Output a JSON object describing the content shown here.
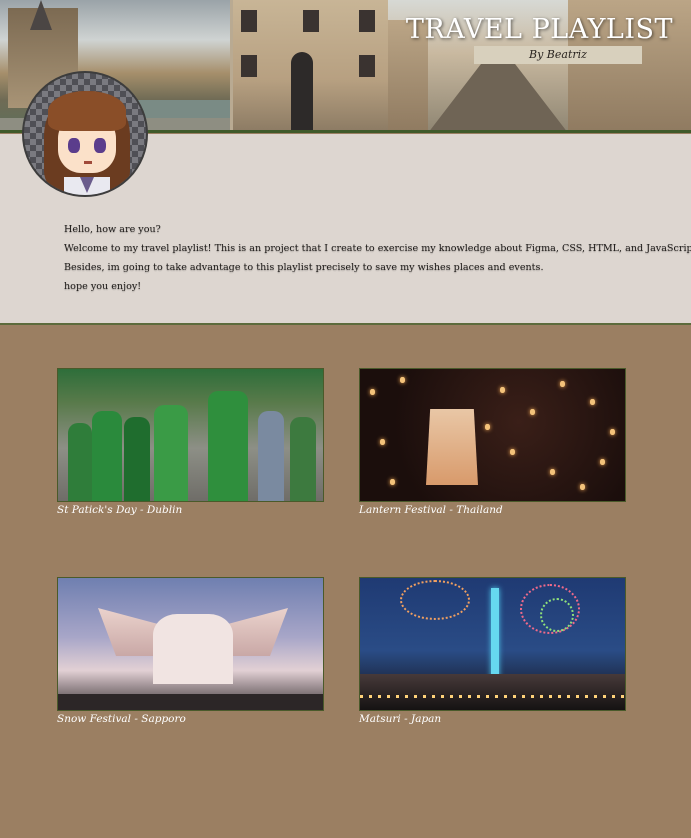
{
  "header": {
    "title": "TRAVEL PLAYLIST",
    "byline": "By Beatriz"
  },
  "intro": {
    "lines": [
      "Hello, how are you?",
      "Welcome to my travel playlist! This is an project that I create to exercise my knowledge about Figma, CSS, HTML, and JavaScript.",
      "Besides, im going to take advantage to this playlist precisely to save my wishes places and events.",
      "hope you enjoy!"
    ]
  },
  "events": [
    {
      "caption": "St Patick's Day - Dublin"
    },
    {
      "caption": "Lantern Festival - Thailand"
    },
    {
      "caption": "Snow Festival - Sapporo"
    },
    {
      "caption": "Matsuri - Japan"
    }
  ],
  "colors": {
    "page_background": "#9b7f62",
    "intro_background": "#ddd6d0",
    "banner_border": "#3f5a2a"
  }
}
